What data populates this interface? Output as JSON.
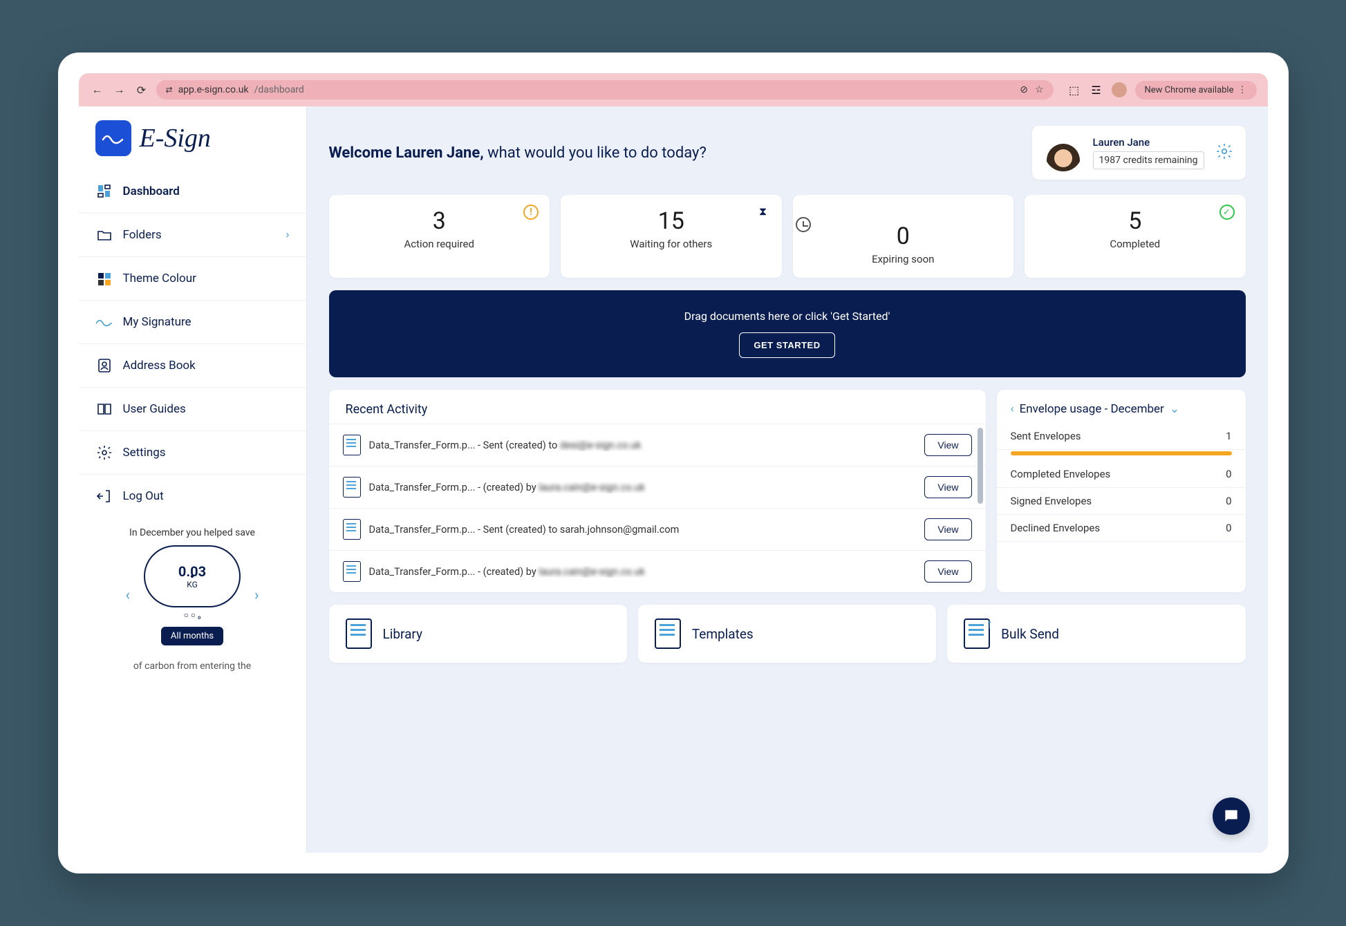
{
  "browser": {
    "url_host": "app.e-sign.co.uk",
    "url_path": "/dashboard",
    "chrome_button": "New Chrome available"
  },
  "brand": {
    "name": "E-Sign"
  },
  "sidebar": {
    "items": [
      {
        "label": "Dashboard",
        "icon": "dashboard-icon",
        "chevron": false,
        "active": true
      },
      {
        "label": "Folders",
        "icon": "folder-icon",
        "chevron": true
      },
      {
        "label": "Theme Colour",
        "icon": "palette-icon",
        "chevron": false
      },
      {
        "label": "My Signature",
        "icon": "signature-icon",
        "chevron": false
      },
      {
        "label": "Address Book",
        "icon": "addressbook-icon",
        "chevron": false
      },
      {
        "label": "User Guides",
        "icon": "book-icon",
        "chevron": false
      },
      {
        "label": "Settings",
        "icon": "settings-icon",
        "chevron": false
      },
      {
        "label": "Log Out",
        "icon": "logout-icon",
        "chevron": false
      }
    ]
  },
  "eco": {
    "intro": "In December you helped save",
    "value": "0.03",
    "unit": "KG",
    "button": "All months",
    "footer": "of carbon from entering the"
  },
  "welcome": {
    "bold": "Welcome Lauren Jane,",
    "rest": " what would you like to do today?"
  },
  "user": {
    "name": "Lauren Jane",
    "credits": "1987 credits remaining"
  },
  "stats": [
    {
      "value": "3",
      "label": "Action required",
      "icon": "warn"
    },
    {
      "value": "15",
      "label": "Waiting for others",
      "icon": "hour"
    },
    {
      "value": "0",
      "label": "Expiring soon",
      "icon": "clock"
    },
    {
      "value": "5",
      "label": "Completed",
      "icon": "check"
    }
  ],
  "drop": {
    "title": "Drag documents here or click 'Get Started'",
    "button": "GET STARTED"
  },
  "activity": {
    "header": "Recent Activity",
    "view": "View",
    "rows": [
      {
        "file": "Data_Transfer_Form.p...",
        "mid": " - Sent (created) to ",
        "tail": "desi@e-sign.co.uk",
        "blur": true
      },
      {
        "file": "Data_Transfer_Form.p...",
        "mid": " - (created) by ",
        "tail": "laura.cain@e-sign.co.uk",
        "blur": true
      },
      {
        "file": "Data_Transfer_Form.p...",
        "mid": " - Sent (created) to ",
        "tail": "sarah.johnson@gmail.com",
        "blur": false
      },
      {
        "file": "Data_Transfer_Form.p...",
        "mid": " - (created) by ",
        "tail": "laura.cain@e-sign.co.uk",
        "blur": true
      }
    ]
  },
  "usage": {
    "header_prefix": "Envelope usage - ",
    "month": "December",
    "rows": [
      {
        "label": "Sent Envelopes",
        "value": "1",
        "bar": true
      },
      {
        "label": "Completed Envelopes",
        "value": "0"
      },
      {
        "label": "Signed Envelopes",
        "value": "0"
      },
      {
        "label": "Declined Envelopes",
        "value": "0"
      }
    ]
  },
  "tiles": [
    {
      "label": "Library",
      "icon": "lib"
    },
    {
      "label": "Templates",
      "icon": "tpl"
    },
    {
      "label": "Bulk Send",
      "icon": "bs"
    }
  ]
}
